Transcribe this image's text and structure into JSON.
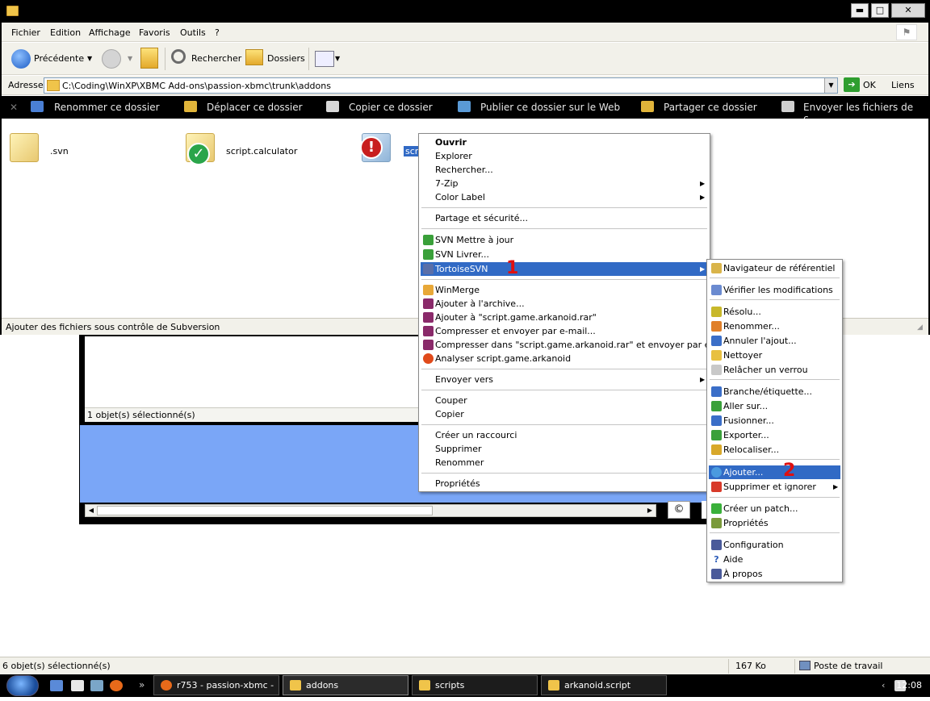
{
  "window": {
    "minimize_glyph": "▬",
    "maximize_glyph": "□",
    "close_glyph": "✕"
  },
  "menubar": {
    "items": [
      "Fichier",
      "Edition",
      "Affichage",
      "Favoris",
      "Outils",
      "?"
    ]
  },
  "toolbar": {
    "back_label": "Précédente",
    "search_label": "Rechercher",
    "folders_label": "Dossiers"
  },
  "address": {
    "label": "Adresse",
    "value": "C:\\Coding\\WinXP\\XBMC Add-ons\\passion-xbmc\\trunk\\addons",
    "go_label": "OK",
    "links_label": "Liens"
  },
  "tasks": {
    "items": [
      "Renommer ce dossier",
      "Déplacer ce dossier",
      "Copier ce dossier",
      "Publier ce dossier sur le Web",
      "Partager ce dossier",
      "Envoyer les fichiers de c..."
    ]
  },
  "files": [
    {
      "name": ".svn",
      "overlay": "none"
    },
    {
      "name": "script.calculator",
      "overlay": "ok"
    },
    {
      "name": "scrip",
      "overlay": "error"
    }
  ],
  "main_status": "Ajouter des fichiers sous contrôle de Subversion",
  "bg_window": {
    "status": "1 objet(s) sélectionné(s)",
    "copyright_glyph": "©"
  },
  "context_menu": {
    "items": [
      {
        "label": "Ouvrir",
        "bold": true
      },
      {
        "label": "Explorer"
      },
      {
        "label": "Rechercher..."
      },
      {
        "label": "7-Zip",
        "submenu": true
      },
      {
        "label": "Color Label",
        "submenu": true
      },
      {
        "label": "Partage et sécurité..."
      },
      {
        "label": "SVN Mettre à jour"
      },
      {
        "label": "SVN Livrer..."
      },
      {
        "label": "TortoiseSVN",
        "submenu": true,
        "highlight": true
      },
      {
        "label": "WinMerge"
      },
      {
        "label": "Ajouter à l'archive..."
      },
      {
        "label": "Ajouter à \"script.game.arkanoid.rar\""
      },
      {
        "label": "Compresser et envoyer par e-mail..."
      },
      {
        "label": "Compresser dans \"script.game.arkanoid.rar\" et envoyer par e-mail"
      },
      {
        "label": "Analyser script.game.arkanoid"
      },
      {
        "label": "Envoyer vers",
        "submenu": true
      },
      {
        "label": "Couper"
      },
      {
        "label": "Copier"
      },
      {
        "label": "Créer un raccourci"
      },
      {
        "label": "Supprimer"
      },
      {
        "label": "Renommer"
      },
      {
        "label": "Propriétés"
      }
    ]
  },
  "svn_submenu": {
    "items": [
      {
        "label": "Navigateur de référentiel"
      },
      {
        "label": "Vérifier les modifications"
      },
      {
        "label": "Résolu..."
      },
      {
        "label": "Renommer..."
      },
      {
        "label": "Annuler l'ajout..."
      },
      {
        "label": "Nettoyer"
      },
      {
        "label": "Relâcher un verrou"
      },
      {
        "label": "Branche/étiquette..."
      },
      {
        "label": "Aller sur..."
      },
      {
        "label": "Fusionner..."
      },
      {
        "label": "Exporter..."
      },
      {
        "label": "Relocaliser..."
      },
      {
        "label": "Ajouter...",
        "highlight": true
      },
      {
        "label": "Supprimer et ignorer",
        "submenu": true
      },
      {
        "label": "Créer un patch..."
      },
      {
        "label": "Propriétés"
      },
      {
        "label": "Configuration"
      },
      {
        "label": "Aide"
      },
      {
        "label": "À propos"
      }
    ]
  },
  "markers": {
    "one": "1",
    "two": "2"
  },
  "low_status": {
    "selection": "6 objet(s) sélectionné(s)",
    "size": "167 Ko",
    "location": "Poste de travail"
  },
  "winbar": {
    "tasks": [
      "r753 - passion-xbmc - ...",
      "addons",
      "scripts",
      "arkanoid.script"
    ],
    "clock": "12:08",
    "chevron": "»",
    "tray_chevron": "‹"
  },
  "colors": {
    "selection": "#316ac5",
    "marker": "#e01010",
    "svn_ok": "#2aa54a",
    "svn_error": "#c81e1e"
  }
}
